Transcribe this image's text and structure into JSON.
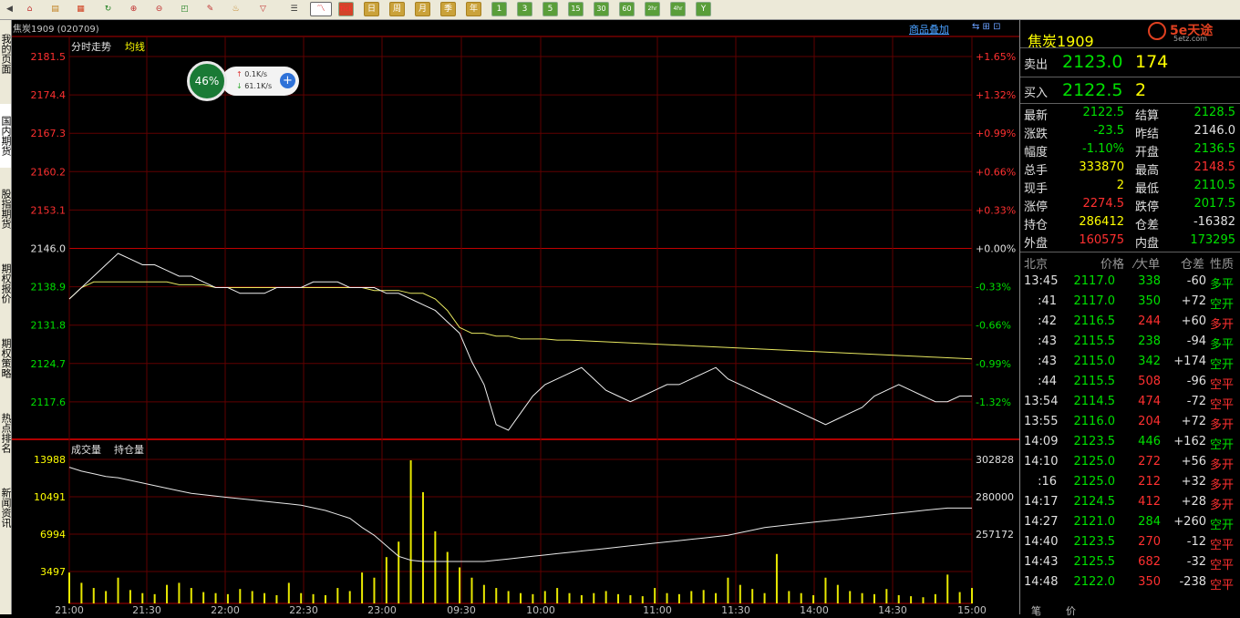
{
  "toolbar": {
    "buttons": [
      "Tick",
      "日",
      "周",
      "月",
      "季",
      "年",
      "1",
      "3",
      "5",
      "15",
      "30",
      "60",
      "2hr",
      "4hr",
      "Y"
    ]
  },
  "left_tabs": [
    "我的页面",
    "国内期货",
    "股指期货",
    "期权报价",
    "期权策略",
    "热点排名",
    "新闻资讯"
  ],
  "header": {
    "symbol": "焦炭1909 (020709)",
    "overlay_button": "商品叠加",
    "title_label": "分时走势",
    "avg_label": "均线",
    "volume_label": "成交量",
    "openint_label": "持仓量"
  },
  "price_axis": {
    "left": [
      "2181.5",
      "2174.4",
      "2167.3",
      "2160.2",
      "2153.1",
      "2146.0",
      "2138.9",
      "2131.8",
      "2124.7",
      "2117.6"
    ],
    "right": [
      "+1.65%",
      "+1.32%",
      "+0.99%",
      "+0.66%",
      "+0.33%",
      "+0.00%",
      "-0.33%",
      "-0.66%",
      "-0.99%",
      "-1.32%"
    ]
  },
  "volume_axis": {
    "left": [
      "13988",
      "10491",
      "6994",
      "3497"
    ],
    "right": [
      "302828",
      "280000",
      "257172"
    ]
  },
  "time_axis": [
    "21:00",
    "21:30",
    "22:00",
    "22:30",
    "23:00",
    "09:30",
    "10:00",
    "11:00",
    "11:30",
    "14:00",
    "14:30",
    "15:00"
  ],
  "speed_widget": {
    "percent": "46%",
    "up": "0.1K/s",
    "down": "61.1K/s"
  },
  "panel": {
    "logo": "5e天途",
    "logo_sub": "5etz.com",
    "title": "焦炭1909",
    "ask_label": "卖出",
    "ask_price": "2123.0",
    "ask_vol": "174",
    "bid_label": "买入",
    "bid_price": "2122.5",
    "bid_vol": "2",
    "stats": [
      {
        "l1": "最新",
        "v1": "2122.5",
        "c1": "green",
        "l2": "结算",
        "v2": "2128.5",
        "c2": "green"
      },
      {
        "l1": "涨跌",
        "v1": "-23.5",
        "c1": "green",
        "l2": "昨结",
        "v2": "2146.0",
        "c2": "white"
      },
      {
        "l1": "幅度",
        "v1": "-1.10%",
        "c1": "green",
        "l2": "开盘",
        "v2": "2136.5",
        "c2": "green"
      },
      {
        "l1": "总手",
        "v1": "333870",
        "c1": "yellow",
        "l2": "最高",
        "v2": "2148.5",
        "c2": "red"
      },
      {
        "l1": "现手",
        "v1": "2",
        "c1": "yellow",
        "l2": "最低",
        "v2": "2110.5",
        "c2": "green"
      },
      {
        "l1": "涨停",
        "v1": "2274.5",
        "c1": "red",
        "l2": "跌停",
        "v2": "2017.5",
        "c2": "green"
      },
      {
        "l1": "持仓",
        "v1": "286412",
        "c1": "yellow",
        "l2": "仓差",
        "v2": "-16382",
        "c2": "white"
      },
      {
        "l1": "外盘",
        "v1": "160575",
        "c1": "red",
        "l2": "内盘",
        "v2": "173295",
        "c2": "green"
      }
    ],
    "ticks_header": {
      "loc": "北京",
      "price": "价格",
      "bigorder": "⁄大单",
      "diff": "仓差",
      "nature": "性质"
    },
    "ticks": [
      {
        "time": "13:45",
        "price": "2117.0",
        "vol": "338",
        "vc": "green",
        "diff": "-60",
        "nature": "多平",
        "nc": "green"
      },
      {
        "time": ":41",
        "price": "2117.0",
        "vol": "350",
        "vc": "green",
        "diff": "+72",
        "nature": "空开",
        "nc": "green"
      },
      {
        "time": ":42",
        "price": "2116.5",
        "vol": "244",
        "vc": "red",
        "diff": "+60",
        "nature": "多开",
        "nc": "red"
      },
      {
        "time": ":43",
        "price": "2115.5",
        "vol": "238",
        "vc": "green",
        "diff": "-94",
        "nature": "多平",
        "nc": "green"
      },
      {
        "time": ":43",
        "price": "2115.0",
        "vol": "342",
        "vc": "green",
        "diff": "+174",
        "nature": "空开",
        "nc": "green"
      },
      {
        "time": ":44",
        "price": "2115.5",
        "vol": "508",
        "vc": "red",
        "diff": "-96",
        "nature": "空平",
        "nc": "red"
      },
      {
        "time": "13:54",
        "price": "2114.5",
        "vol": "474",
        "vc": "red",
        "diff": "-72",
        "nature": "空平",
        "nc": "red"
      },
      {
        "time": "13:55",
        "price": "2116.0",
        "vol": "204",
        "vc": "red",
        "diff": "+72",
        "nature": "多开",
        "nc": "red"
      },
      {
        "time": "14:09",
        "price": "2123.5",
        "vol": "446",
        "vc": "green",
        "diff": "+162",
        "nature": "空开",
        "nc": "green"
      },
      {
        "time": "14:10",
        "price": "2125.0",
        "vol": "272",
        "vc": "red",
        "diff": "+56",
        "nature": "多开",
        "nc": "red"
      },
      {
        "time": ":16",
        "price": "2125.0",
        "vol": "212",
        "vc": "red",
        "diff": "+32",
        "nature": "多开",
        "nc": "red"
      },
      {
        "time": "14:17",
        "price": "2124.5",
        "vol": "412",
        "vc": "red",
        "diff": "+28",
        "nature": "多开",
        "nc": "red"
      },
      {
        "time": "14:27",
        "price": "2121.0",
        "vol": "284",
        "vc": "green",
        "diff": "+260",
        "nature": "空开",
        "nc": "green"
      },
      {
        "time": "14:40",
        "price": "2123.5",
        "vol": "270",
        "vc": "red",
        "diff": "-12",
        "nature": "空平",
        "nc": "red"
      },
      {
        "time": "14:43",
        "price": "2125.5",
        "vol": "682",
        "vc": "red",
        "diff": "-32",
        "nature": "空平",
        "nc": "red"
      },
      {
        "time": "14:48",
        "price": "2122.0",
        "vol": "350",
        "vc": "red",
        "diff": "-238",
        "nature": "空平",
        "nc": "red"
      }
    ],
    "bottom_tabs": [
      "笔",
      "价"
    ]
  },
  "chart_data": {
    "type": "line",
    "prev_settle": 2146.0,
    "ylim": [
      2114.0,
      2183.0
    ],
    "price": [
      2139,
      2141,
      2143,
      2145,
      2147,
      2146,
      2145,
      2145,
      2144,
      2143,
      2143,
      2142,
      2141,
      2141,
      2140,
      2140,
      2140,
      2141,
      2141,
      2141,
      2142,
      2142,
      2142,
      2141,
      2141,
      2141,
      2140,
      2140,
      2139,
      2138,
      2137,
      2135,
      2133,
      2128,
      2124,
      2117,
      2116,
      2119,
      2122,
      2124,
      2125,
      2126,
      2127,
      2125,
      2123,
      2122,
      2121,
      2122,
      2123,
      2124,
      2124,
      2125,
      2126,
      2127,
      2125,
      2124,
      2123,
      2122,
      2121,
      2120,
      2119,
      2118,
      2117,
      2118,
      2119,
      2120,
      2122,
      2123,
      2124,
      2123,
      2122,
      2121,
      2121,
      2122,
      2122
    ],
    "avg": [
      2139,
      2141,
      2142,
      2142,
      2142,
      2142,
      2142,
      2142,
      2142,
      2141.5,
      2141.5,
      2141.5,
      2141,
      2141,
      2141,
      2141,
      2141,
      2141,
      2141,
      2141,
      2141,
      2141,
      2141,
      2141,
      2141,
      2140.5,
      2140.5,
      2140.5,
      2140,
      2140,
      2139,
      2137,
      2134,
      2133,
      2133,
      2132.5,
      2132.5,
      2132,
      2132,
      2132,
      2131.8,
      2131.8,
      2131.7,
      2131.6,
      2131.5,
      2131.4,
      2131.3,
      2131.2,
      2131.1,
      2131,
      2130.9,
      2130.8,
      2130.7,
      2130.6,
      2130.5,
      2130.4,
      2130.3,
      2130.2,
      2130.1,
      2130,
      2129.9,
      2129.8,
      2129.7,
      2129.6,
      2129.5,
      2129.4,
      2129.3,
      2129.2,
      2129.1,
      2129,
      2128.9,
      2128.8,
      2128.7,
      2128.6,
      2128.5
    ],
    "openint": [
      302000,
      300500,
      299500,
      298500,
      298000,
      297000,
      296000,
      295000,
      294000,
      293000,
      292000,
      291500,
      291000,
      290500,
      290000,
      289500,
      289000,
      288500,
      288000,
      287500,
      286500,
      285500,
      284000,
      282500,
      279000,
      276000,
      272000,
      268000,
      266500,
      266000,
      266000,
      266000,
      266000,
      266000,
      266000,
      266500,
      267000,
      267500,
      268000,
      268500,
      269000,
      269500,
      270000,
      270500,
      271000,
      271500,
      272000,
      272500,
      273000,
      273500,
      274000,
      274500,
      275000,
      275500,
      276000,
      277000,
      278000,
      279000,
      279500,
      280000,
      280500,
      281000,
      281500,
      282000,
      282500,
      283000,
      283500,
      284000,
      284500,
      285000,
      285500,
      286000,
      286412,
      286412,
      286412
    ],
    "volume": [
      3000,
      2000,
      1500,
      1200,
      2500,
      1300,
      1000,
      900,
      1800,
      2000,
      1500,
      1100,
      1000,
      900,
      1400,
      1200,
      1000,
      800,
      2000,
      1000,
      900,
      800,
      1500,
      1200,
      3000,
      2500,
      4500,
      6000,
      13900,
      10800,
      7000,
      5000,
      3500,
      2500,
      1800,
      1500,
      1200,
      1000,
      900,
      1200,
      1500,
      1000,
      800,
      1000,
      1200,
      900,
      800,
      700,
      1500,
      1000,
      900,
      1200,
      1300,
      1000,
      2500,
      1800,
      1400,
      1000,
      4800,
      1200,
      1000,
      800,
      2500,
      1800,
      1200,
      1000,
      900,
      1400,
      800,
      700,
      600,
      900,
      2800,
      1100,
      1500
    ],
    "vol_ylim": [
      0,
      13988
    ],
    "oi_ylim": [
      250000,
      305000
    ]
  }
}
